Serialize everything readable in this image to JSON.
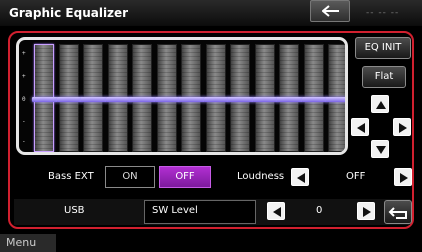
{
  "header": {
    "title": "Graphic Equalizer",
    "faded_label": "-- -- --"
  },
  "eq": {
    "scale_labels": [
      "+",
      "+",
      "0",
      "-",
      "-"
    ],
    "bands": [
      {
        "level": 0,
        "selected": true
      },
      {
        "level": 0,
        "selected": false
      },
      {
        "level": 0,
        "selected": false
      },
      {
        "level": 0,
        "selected": false
      },
      {
        "level": 0,
        "selected": false
      },
      {
        "level": 0,
        "selected": false
      },
      {
        "level": 0,
        "selected": false
      },
      {
        "level": 0,
        "selected": false
      },
      {
        "level": 0,
        "selected": false
      },
      {
        "level": 0,
        "selected": false
      },
      {
        "level": 0,
        "selected": false
      },
      {
        "level": 0,
        "selected": false
      },
      {
        "level": 0,
        "selected": false
      }
    ]
  },
  "buttons": {
    "eq_init": "EQ INIT",
    "flat": "Flat"
  },
  "bass_ext": {
    "label": "Bass EXT",
    "on": "ON",
    "off": "OFF",
    "selected": "OFF"
  },
  "loudness": {
    "label": "Loudness",
    "value": "OFF"
  },
  "source": {
    "label": "USB"
  },
  "sw_level": {
    "label": "SW Level",
    "value": "0"
  },
  "footer": {
    "menu": "Menu"
  },
  "colors": {
    "frame": "#d1202f",
    "accent": "#8f23b3",
    "knob": "#9d8cff"
  }
}
